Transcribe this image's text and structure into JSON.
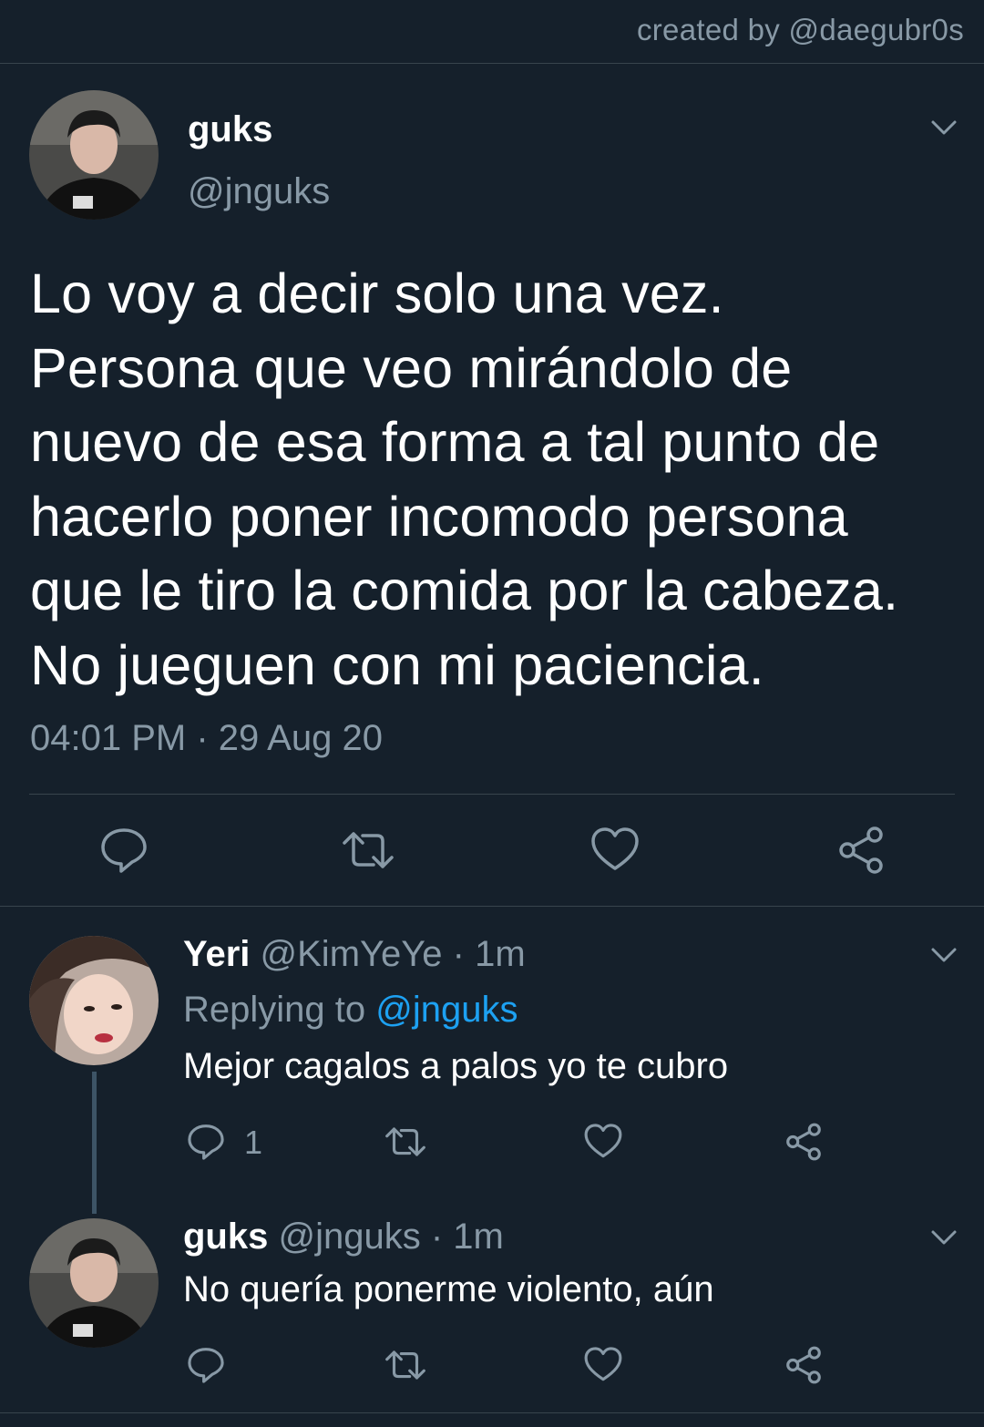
{
  "credit": "created by @daegubr0s",
  "main_tweet": {
    "name": "guks",
    "handle": "@jnguks",
    "lines": [
      "Lo voy a decir solo una vez.",
      "Persona que veo mirándolo de",
      "nuevo de esa forma a tal punto de",
      "hacerlo poner incomodo persona",
      "que le tiro la comida por la cabeza.",
      "No jueguen con mi paciencia."
    ],
    "timestamp": "04:01 PM · 29 Aug 20"
  },
  "reply1": {
    "name": "Yeri",
    "meta": " @KimYeYe · 1m",
    "replying_prefix": "Replying to ",
    "replying_mention": "@jnguks",
    "text": "Mejor cagalos a palos yo te cubro",
    "reply_count": "1"
  },
  "reply2": {
    "name": "guks",
    "meta": " @jnguks · 1m",
    "text": "No quería ponerme violento, aún"
  },
  "colors": {
    "background": "#15202b",
    "secondary_text": "#8899a6",
    "mention": "#1da1f2",
    "divider": "#38444d"
  },
  "icons": [
    "chevron-down-icon",
    "reply-icon",
    "retweet-icon",
    "like-icon",
    "share-icon"
  ]
}
